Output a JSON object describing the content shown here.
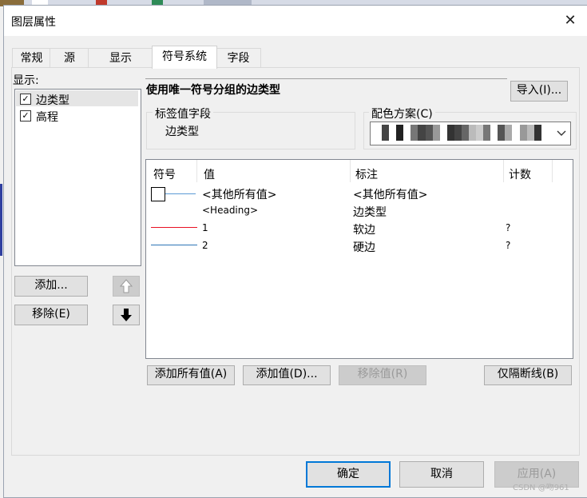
{
  "dialog": {
    "title": "图层属性",
    "close_glyph": "✕"
  },
  "tabs": [
    {
      "label": "常规",
      "active": false
    },
    {
      "label": "源",
      "active": false
    },
    {
      "label": "显示",
      "active": false
    },
    {
      "label": "符号系统",
      "active": true
    },
    {
      "label": "字段",
      "active": false
    }
  ],
  "left_panel": {
    "show_label": "显示:",
    "items": [
      {
        "label": "边类型",
        "checked": true,
        "selected": true
      },
      {
        "label": "高程",
        "checked": true,
        "selected": false
      }
    ],
    "add_button": "添加...",
    "remove_button": "移除(E)",
    "move_up_icon": "arrow-up-icon",
    "move_down_icon": "arrow-down-icon"
  },
  "symbology": {
    "heading": "使用唯一符号分组的边类型",
    "import_button": "导入(I)...",
    "label_field": {
      "title": "标签值字段",
      "value": "边类型"
    },
    "color_scheme": {
      "title": "配色方案(C)",
      "colors": [
        "#ffffff",
        "#444444",
        "#ffffff",
        "#222222",
        "#ffffff",
        "#777777",
        "#444444",
        "#555555",
        "#999999",
        "#ffffff",
        "#333333",
        "#444444",
        "#666666",
        "#bbbbbb",
        "#cccccc",
        "#777777",
        "#ffffff",
        "#555555",
        "#aaaaaa",
        "#ffffff",
        "#999999",
        "#bbbbbb",
        "#333333",
        "#ffffff"
      ]
    },
    "table": {
      "columns": [
        "符号",
        "值",
        "标注",
        "计数"
      ],
      "rows": [
        {
          "symbol": "box-line",
          "symbol_color": "#5b9bd5",
          "value": "<其他所有值>",
          "label": "<其他所有值>",
          "count": ""
        },
        {
          "symbol": "none",
          "symbol_color": "",
          "value": "<Heading>",
          "label": "边类型",
          "count": ""
        },
        {
          "symbol": "line",
          "symbol_color": "#e81123",
          "value": "1",
          "label": "软边",
          "count": "?"
        },
        {
          "symbol": "line",
          "symbol_color": "#2e75b6",
          "value": "2",
          "label": "硬边",
          "count": "?"
        }
      ]
    },
    "buttons": {
      "add_all": "添加所有值(A)",
      "add_value": "添加值(D)...",
      "remove_value": "移除值(R)",
      "only_breaks": "仅隔断线(B)"
    }
  },
  "footer": {
    "ok": "确定",
    "cancel": "取消",
    "apply": "应用(A)",
    "watermark": "CSDN @吻961"
  }
}
